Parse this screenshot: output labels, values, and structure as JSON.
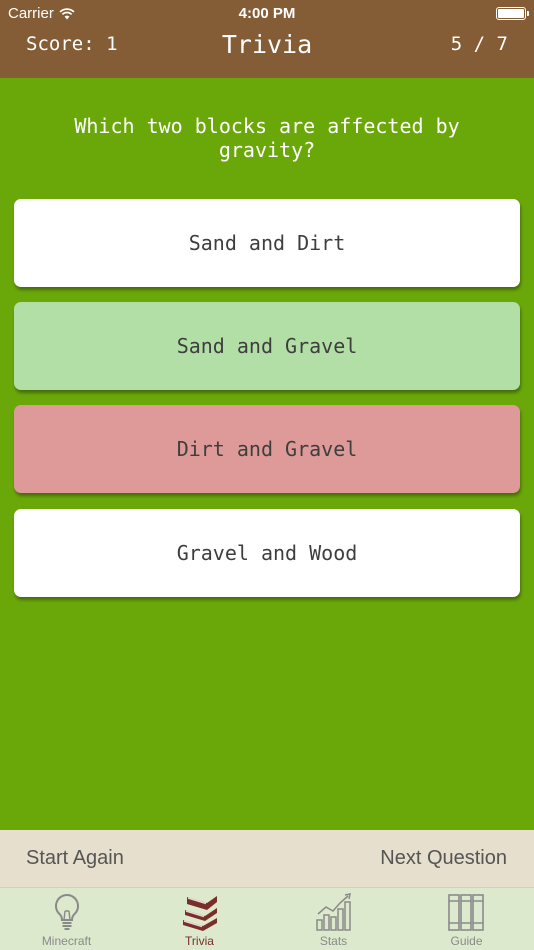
{
  "status": {
    "carrier": "Carrier",
    "time": "4:00 PM"
  },
  "nav": {
    "score": "Score: 1",
    "title": "Trivia",
    "progress": "5 / 7"
  },
  "question": "Which two blocks are affected by gravity?",
  "answers": [
    {
      "label": "Sand and Dirt",
      "state": "neutral",
      "color": "#ffffff"
    },
    {
      "label": "Sand and Gravel",
      "state": "correct",
      "color": "#b2dfa6"
    },
    {
      "label": "Dirt and Gravel",
      "state": "wrong",
      "color": "#de9a99"
    },
    {
      "label": "Gravel and Wood",
      "state": "neutral",
      "color": "#ffffff"
    }
  ],
  "actions": {
    "start_again": "Start Again",
    "next_question": "Next Question"
  },
  "tabs": [
    {
      "label": "Minecraft",
      "icon": "lightbulb-icon",
      "active": false
    },
    {
      "label": "Trivia",
      "icon": "books-icon",
      "active": true
    },
    {
      "label": "Stats",
      "icon": "bar-chart-icon",
      "active": false
    },
    {
      "label": "Guide",
      "icon": "bookshelf-icon",
      "active": false
    }
  ],
  "colors": {
    "header": "#845d37",
    "background": "#6aa80a",
    "action_bar": "#e7dfcd",
    "tab_bar": "#dce9cc",
    "tab_active": "#7a2e2a",
    "tab_inactive": "#8a8a8a"
  }
}
